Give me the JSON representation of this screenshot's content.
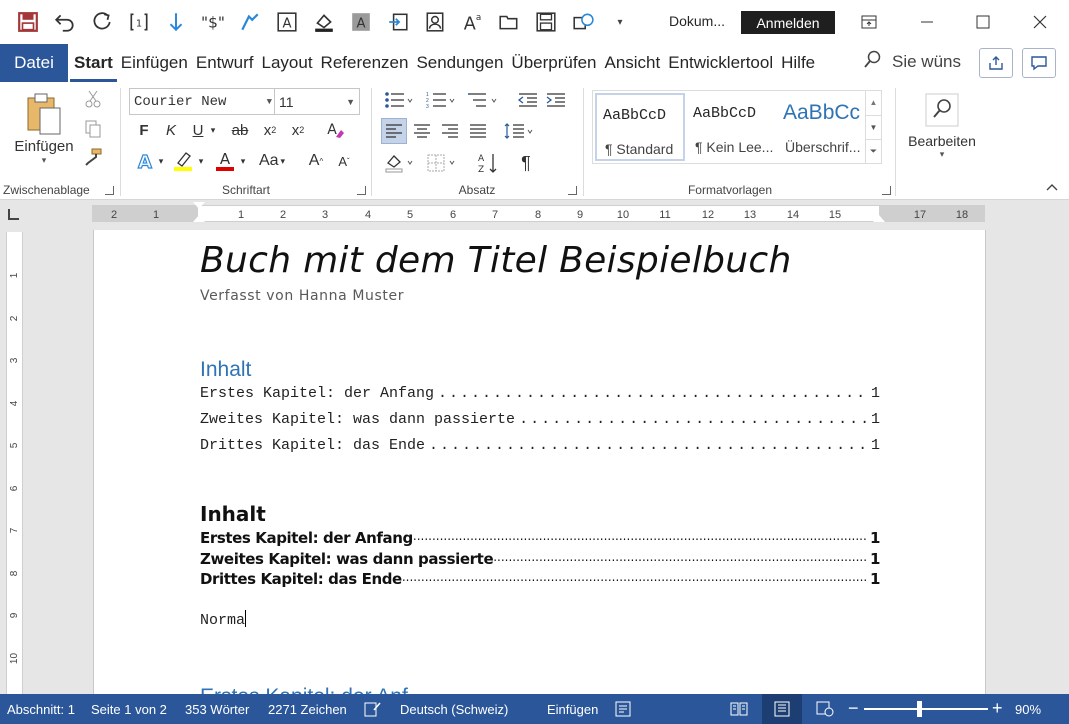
{
  "window": {
    "doc_title": "Dokum...",
    "signin_label": "Anmelden"
  },
  "tabs": [
    "Datei",
    "Start",
    "Einfügen",
    "Entwurf",
    "Layout",
    "Referenzen",
    "Sendungen",
    "Überprüfen",
    "Ansicht",
    "Entwicklertool",
    "Hilfe"
  ],
  "search": {
    "placeholder": "Sie wüns"
  },
  "ribbon": {
    "clipboard": {
      "label": "Zwischenablage",
      "paste_label": "Einfügen"
    },
    "font": {
      "label": "Schriftart",
      "family": "Courier New",
      "size": "11",
      "bold": "F",
      "italic": "K",
      "underline": "U",
      "strike": "ab",
      "change_case": "Aa",
      "grow": "A",
      "shrink": "A",
      "highlight_color": "#ffff00",
      "font_color": "#e00000"
    },
    "paragraph": {
      "label": "Absatz"
    },
    "styles": {
      "label": "Formatvorlagen",
      "items": [
        {
          "preview": "AaBbCcD",
          "name": "¶ Standard"
        },
        {
          "preview": "AaBbCcD",
          "name": "¶ Kein Lee..."
        },
        {
          "preview": "AaBbCc",
          "name": "Überschrif..."
        }
      ]
    },
    "editing": {
      "label": "Bearbeiten"
    }
  },
  "ruler": {
    "h_ticks": [
      "2",
      "1",
      "1",
      "2",
      "3",
      "4",
      "5",
      "6",
      "7",
      "8",
      "9",
      "10",
      "11",
      "12",
      "13",
      "14",
      "15",
      "17",
      "18"
    ],
    "v_ticks": [
      "1",
      "2",
      "3",
      "4",
      "5",
      "6",
      "7",
      "8",
      "9",
      "10"
    ]
  },
  "document": {
    "title": "Buch mit dem Titel Beispielbuch",
    "subtitle": "Verfasst von Hanna Muster",
    "toc1": {
      "heading": "Inhalt",
      "entries": [
        {
          "title": "Erstes Kapitel: der Anfang",
          "page": "1"
        },
        {
          "title": "Zweites Kapitel: was dann passierte",
          "page": "1"
        },
        {
          "title": "Drittes Kapitel: das Ende",
          "page": "1"
        }
      ]
    },
    "toc2": {
      "heading": "Inhalt",
      "entries": [
        {
          "title": "Erstes Kapitel: der Anfang",
          "page": "1"
        },
        {
          "title": "Zweites Kapitel: was dann passierte",
          "page": "1"
        },
        {
          "title": "Drittes Kapitel: das Ende",
          "page": "1"
        }
      ]
    },
    "typed_text": "Norma",
    "next_heading_partial": "Erstes Kapitel: der Anf"
  },
  "status": {
    "section": "Abschnitt: 1",
    "page": "Seite 1 von 2",
    "words": "353 Wörter",
    "chars": "2271 Zeichen",
    "language": "Deutsch (Schweiz)",
    "mode": "Einfügen",
    "zoom": "90%",
    "zoom_level": 0.45
  }
}
